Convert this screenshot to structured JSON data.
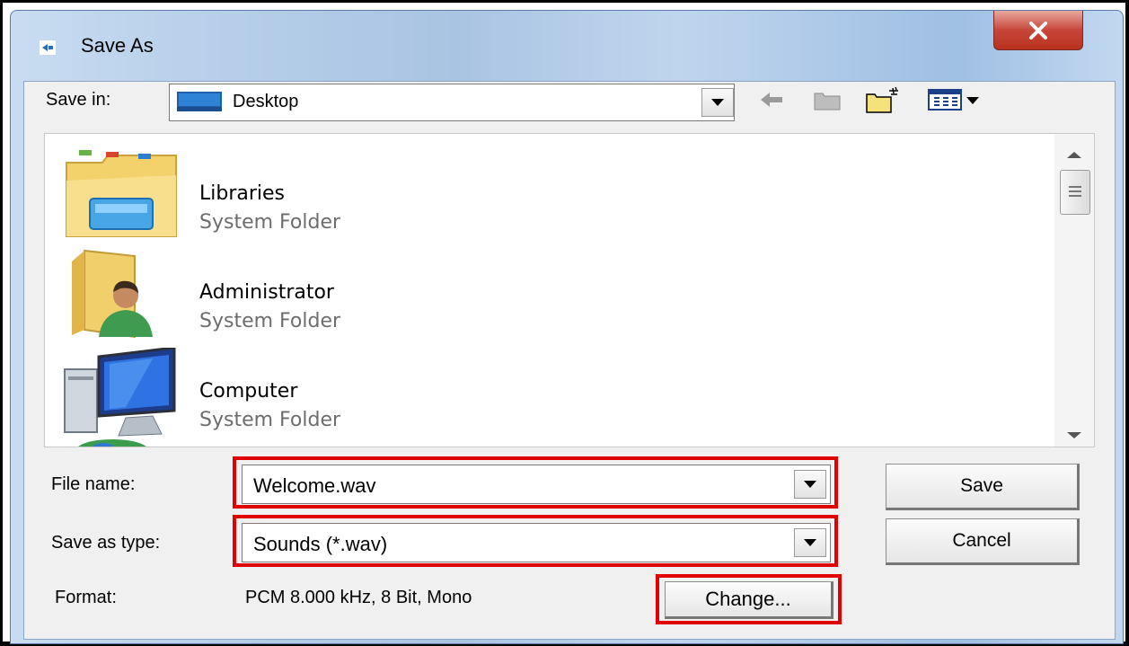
{
  "window": {
    "title": "Save As"
  },
  "toolbar": {
    "save_in_label": "Save in:",
    "location": "Desktop",
    "icons": [
      "back-arrow-icon",
      "up-folder-icon",
      "new-folder-icon",
      "view-menu-icon"
    ]
  },
  "files": [
    {
      "name": "Libraries",
      "type": "System Folder",
      "icon": "libraries-folder-icon"
    },
    {
      "name": "Administrator",
      "type": "System Folder",
      "icon": "user-folder-icon"
    },
    {
      "name": "Computer",
      "type": "System Folder",
      "icon": "computer-icon"
    }
  ],
  "form": {
    "file_name_label": "File name:",
    "file_name_value": "Welcome.wav",
    "save_as_type_label": "Save as type:",
    "save_as_type_value": "Sounds (*.wav)",
    "format_label": "Format:",
    "format_value": "PCM 8.000 kHz, 8 Bit, Mono"
  },
  "buttons": {
    "save": "Save",
    "cancel": "Cancel",
    "change": "Change..."
  },
  "colors": {
    "highlight": "#e00000",
    "close_button": "#c7463a"
  }
}
